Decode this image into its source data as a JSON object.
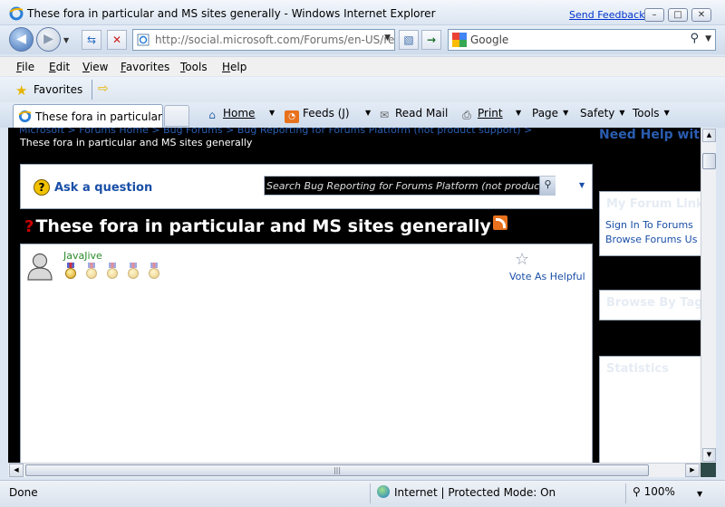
{
  "window": {
    "title": "These fora in particular and MS sites generally - Windows Internet Explorer",
    "send_feedback": "Send Feedback",
    "minimize": "–",
    "maximize": "□",
    "close": "✕"
  },
  "address_bar": {
    "url": "http://social.microsoft.com/Forums/en-US/re|",
    "search_placeholder": "Google"
  },
  "menu": [
    "File",
    "Edit",
    "View",
    "Favorites",
    "Tools",
    "Help"
  ],
  "favorites_bar": {
    "label": "Favorites"
  },
  "tab": {
    "label": "These fora in particular..."
  },
  "commands": {
    "home": "Home",
    "feeds": "Feeds (J)",
    "read_mail": "Read Mail",
    "print": "Print",
    "page": "Page",
    "safety": "Safety",
    "tools": "Tools"
  },
  "page": {
    "breadcrumb": "Microsoft > Forums Home > Bug Forums > Bug Reporting for Forums Platform (not product support) >",
    "breadcrumb_current": "These fora in particular and MS sites generally",
    "ask_question": "Ask a question",
    "search_placeholder": "Search Bug Reporting for Forums Platform (not product support)",
    "thread_title": "These fora in particular and MS sites generally",
    "post": {
      "author": "JavaJive",
      "vote_label": "Vote As Helpful",
      "medals_total": 5
    },
    "sidebar": {
      "help_heading": "Need Help with Forums? (FAQ)",
      "my_forum_links": "My Forum Links",
      "sign_in_link": "Sign In To Forums",
      "browse_link": "Browse Forums Us",
      "browse_by_tag": "Browse By Tag",
      "statistics": "Statistics"
    }
  },
  "status": {
    "text": "Done",
    "zone": "Internet | Protected Mode: On",
    "zoom": "100%"
  }
}
